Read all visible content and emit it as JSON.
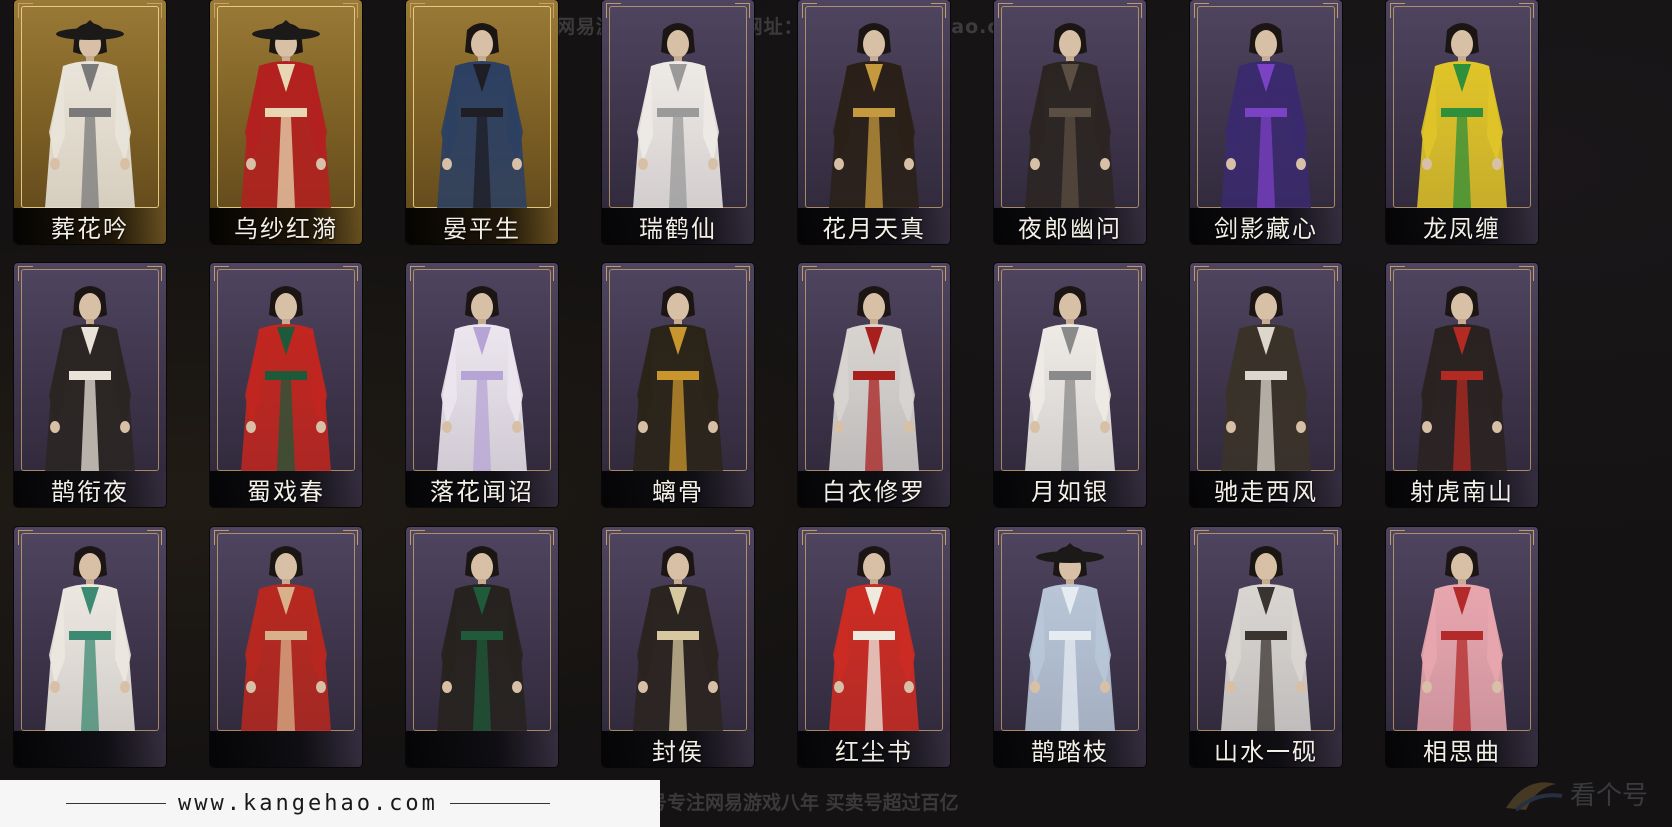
{
  "watermark_top": "网易游戏精选看个号   网址：www.kangehao.com",
  "watermark_bottom": "看个号专注网易游戏八年  买卖号超过百亿",
  "banner": {
    "url": "www.kangehao.com"
  },
  "corner_logo_text": "看个号",
  "colors": {
    "gold_card": "#8a6a2c",
    "purple_card": "#4a4059",
    "background": "#141212",
    "banner": "#f6f6f6"
  },
  "outfits": [
    {
      "name": "葬花吟",
      "style": "gold",
      "robe": "#e9e4da",
      "accent": "#7a7a7a",
      "hat": true
    },
    {
      "name": "乌纱红漪",
      "style": "gold",
      "robe": "#b3201f",
      "accent": "#e8d7b2",
      "hat": true
    },
    {
      "name": "晏平生",
      "style": "gold",
      "robe": "#2c4063",
      "accent": "#1e1e24",
      "hat": false
    },
    {
      "name": "瑞鹤仙",
      "style": "purple",
      "robe": "#eeeae6",
      "accent": "#9a9a9a",
      "hat": false
    },
    {
      "name": "花月天真",
      "style": "purple",
      "robe": "#2a2018",
      "accent": "#c59a3e",
      "hat": false
    },
    {
      "name": "夜郎幽问",
      "style": "purple",
      "robe": "#2b2522",
      "accent": "#5b4e42",
      "hat": false
    },
    {
      "name": "剑影藏心",
      "style": "purple",
      "robe": "#3a2a6e",
      "accent": "#7c42c4",
      "hat": false
    },
    {
      "name": "龙凤缠",
      "style": "purple",
      "robe": "#e0c428",
      "accent": "#2f8f3a",
      "hat": false
    },
    {
      "name": "鹊衔夜",
      "style": "purple",
      "robe": "#2a2522",
      "accent": "#e8e2d8",
      "hat": false
    },
    {
      "name": "蜀戏春",
      "style": "purple",
      "robe": "#c2261f",
      "accent": "#1d5a3a",
      "hat": false
    },
    {
      "name": "落花闻诏",
      "style": "purple",
      "robe": "#ece6ee",
      "accent": "#b7a4d6",
      "hat": false
    },
    {
      "name": "螭骨",
      "style": "purple",
      "robe": "#2a2418",
      "accent": "#c9962e",
      "hat": false
    },
    {
      "name": "白衣修罗",
      "style": "purple",
      "robe": "#d7d4d0",
      "accent": "#a8201e",
      "hat": false
    },
    {
      "name": "月如银",
      "style": "purple",
      "robe": "#eeebe6",
      "accent": "#8a8a8a",
      "hat": false
    },
    {
      "name": "驰走西风",
      "style": "purple",
      "robe": "#3a3228",
      "accent": "#dcd6cc",
      "hat": false
    },
    {
      "name": "射虎南山",
      "style": "purple",
      "robe": "#2a2220",
      "accent": "#b32a22",
      "hat": false
    },
    {
      "name": "",
      "style": "purple",
      "robe": "#ece8e0",
      "accent": "#3c8a72",
      "hat": false
    },
    {
      "name": "",
      "style": "purple",
      "robe": "#b7281f",
      "accent": "#d8b08a",
      "hat": false
    },
    {
      "name": "",
      "style": "purple",
      "robe": "#26221e",
      "accent": "#1f5a3a",
      "hat": false
    },
    {
      "name": "封侯",
      "style": "purple",
      "robe": "#2a2420",
      "accent": "#d8c8a0",
      "hat": false
    },
    {
      "name": "红尘书",
      "style": "purple",
      "robe": "#cc2b22",
      "accent": "#eeeae0",
      "hat": false
    },
    {
      "name": "鹊踏枝",
      "style": "purple",
      "robe": "#b8c6d8",
      "accent": "#e6ebf2",
      "hat": true
    },
    {
      "name": "山水一砚",
      "style": "purple",
      "robe": "#d9d6d2",
      "accent": "#3a3430",
      "hat": false
    },
    {
      "name": "相思曲",
      "style": "purple",
      "robe": "#e8a6ae",
      "accent": "#b32a2a",
      "hat": false
    }
  ]
}
